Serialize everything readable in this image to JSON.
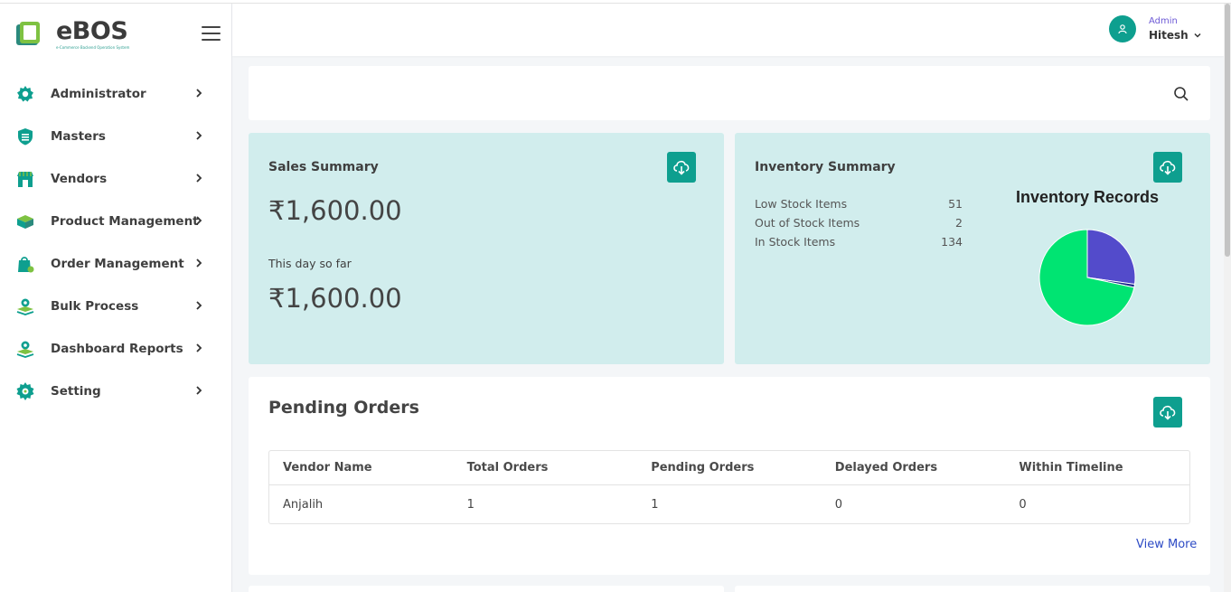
{
  "colors": {
    "accent": "#0e9f8f",
    "card_bg": "#d1eded",
    "link": "#2d4bc5",
    "pie_green": "#00e472",
    "pie_purple": "#534bcb"
  },
  "brand": {
    "title": "eBOS",
    "subtitle": "e-Commerce Backend Operation System"
  },
  "sidebar": {
    "items": [
      {
        "label": "Administrator",
        "icon": "admin-gear-icon"
      },
      {
        "label": "Masters",
        "icon": "shield-icon"
      },
      {
        "label": "Vendors",
        "icon": "store-icon"
      },
      {
        "label": "Product Management",
        "icon": "box-icon"
      },
      {
        "label": "Order Management",
        "icon": "shopping-bag-icon"
      },
      {
        "label": "Bulk Process",
        "icon": "layers-gear-icon"
      },
      {
        "label": "Dashboard Reports",
        "icon": "layers-gear-icon"
      },
      {
        "label": "Setting",
        "icon": "gear-icon"
      }
    ]
  },
  "header": {
    "user_role": "Admin",
    "user_name": "Hitesh"
  },
  "sales": {
    "title": "Sales Summary",
    "total": "₹1,600.00",
    "today_label": "This day so far",
    "today": "₹1,600.00"
  },
  "inventory": {
    "title": "Inventory Summary",
    "rows": [
      {
        "label": "Low Stock Items",
        "value": "51"
      },
      {
        "label": "Out of Stock Items",
        "value": "2"
      },
      {
        "label": "In Stock Items",
        "value": "134"
      }
    ]
  },
  "chart_data": {
    "type": "pie",
    "title": "Inventory Records",
    "categories": [
      "Low Stock Items",
      "Out of Stock Items",
      "In Stock Items"
    ],
    "values": [
      51,
      2,
      134
    ]
  },
  "orders": {
    "title": "Pending Orders",
    "columns": [
      "Vendor Name",
      "Total Orders",
      "Pending Orders",
      "Delayed Orders",
      "Within Timeline"
    ],
    "rows": [
      [
        "Anjalih",
        "1",
        "1",
        "0",
        "0"
      ]
    ],
    "view_more": "View More"
  }
}
